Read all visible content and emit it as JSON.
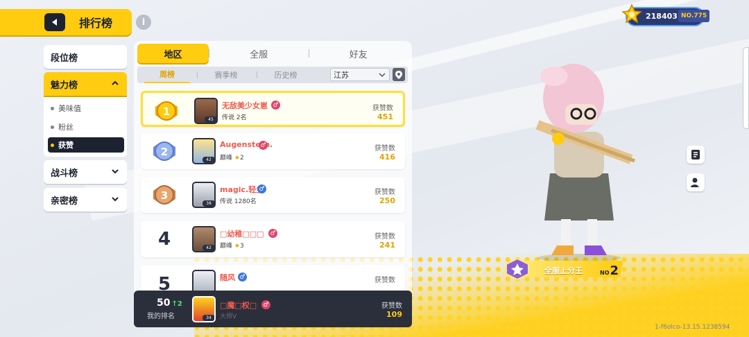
{
  "header": {
    "title": "排行榜"
  },
  "sidebar": {
    "items": [
      {
        "label": "段位榜"
      },
      {
        "label": "魅力榜"
      },
      {
        "label": "战斗榜"
      },
      {
        "label": "亲密榜"
      }
    ],
    "sub_items": [
      {
        "label": "美味值"
      },
      {
        "label": "粉丝"
      },
      {
        "label": "获赞"
      }
    ]
  },
  "tabs": [
    {
      "label": "地区"
    },
    {
      "label": "全服"
    },
    {
      "label": "好友"
    }
  ],
  "subtabs": [
    {
      "label": "周榜"
    },
    {
      "label": "赛季榜"
    },
    {
      "label": "历史榜"
    }
  ],
  "region": {
    "selected": "江苏"
  },
  "likes_label": "获赞数",
  "leaderboard": [
    {
      "rank": "1",
      "name": "无敌美少女崽",
      "gender": "♂",
      "tier": "传说 2名",
      "level": "45",
      "likes": "451"
    },
    {
      "rank": "2",
      "name": "Augenstern.",
      "gender": "♂",
      "tier": "巅峰",
      "stars": "2",
      "level": "42",
      "likes": "416"
    },
    {
      "rank": "3",
      "name": "magic.轻尘",
      "gender": "♂",
      "tier": "传说 1280名",
      "level": "38",
      "likes": "250"
    },
    {
      "rank": "4",
      "name": "□幼稚□□□",
      "gender": "♂",
      "tier": "巅峰",
      "stars": "3",
      "level": "42",
      "likes": "241"
    },
    {
      "rank": "5",
      "name": "随风",
      "gender": "♂",
      "tier": "",
      "level": "",
      "likes": ""
    }
  ],
  "my_rank": {
    "rank": "50",
    "change": "2",
    "label": "我的排名",
    "name": "□魔□权□",
    "gender": "♂",
    "tier": "大师V",
    "level": "34",
    "likes": "109"
  },
  "currency": {
    "value": "218403",
    "no": "NO.775"
  },
  "award": {
    "label": "全服上分王",
    "no_prefix": "NO",
    "no_value": "2"
  },
  "build": "1-f6olco-13.15.1238594",
  "colors": {
    "accent": "#ffcc10",
    "dark": "#1d2230",
    "name_red": "#ef5a4e",
    "female_pink": "#e0446b",
    "male_blue": "#3d78d6"
  }
}
